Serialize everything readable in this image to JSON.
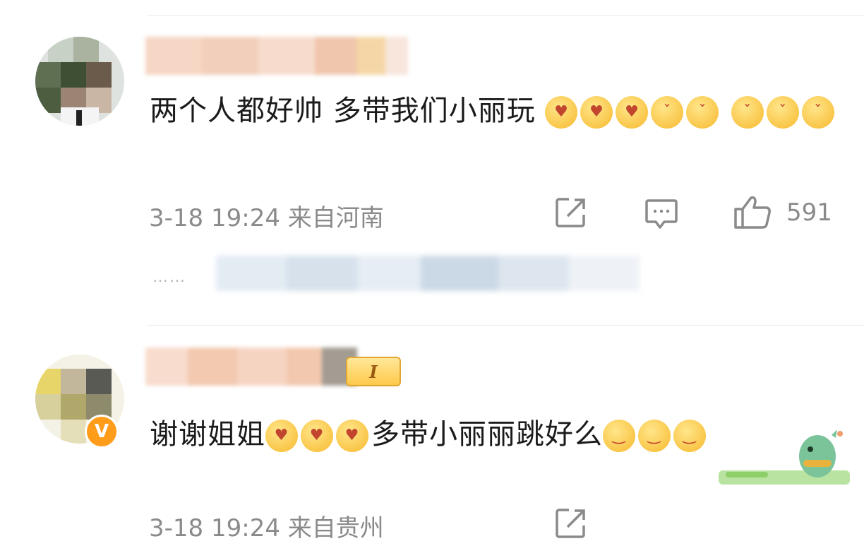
{
  "comments": [
    {
      "text": "两个人都好帅 多带我们小丽玩",
      "time_location": "3-18 19:24 来自河南",
      "likes": "591",
      "emoji_summary": [
        "heart-eyes",
        "heart-eyes",
        "heart-eyes",
        "kiss",
        "kiss",
        "kiss",
        "kiss",
        "kiss"
      ]
    },
    {
      "text_part1": "谢谢姐姐",
      "text_part2": "多带小丽丽跳好么",
      "time_location": "3-18 19:24 来自贵州",
      "verified_badge": "V",
      "level_badge": "I"
    }
  ],
  "reply_preview": "……",
  "colors": {
    "text": "#1b1b1b",
    "meta": "#8a8a8a",
    "divider": "#ececec",
    "verified": "#ff9c1a",
    "level_badge": "#ffc94a"
  },
  "icons": [
    "forward-icon",
    "comment-icon",
    "like-icon"
  ]
}
